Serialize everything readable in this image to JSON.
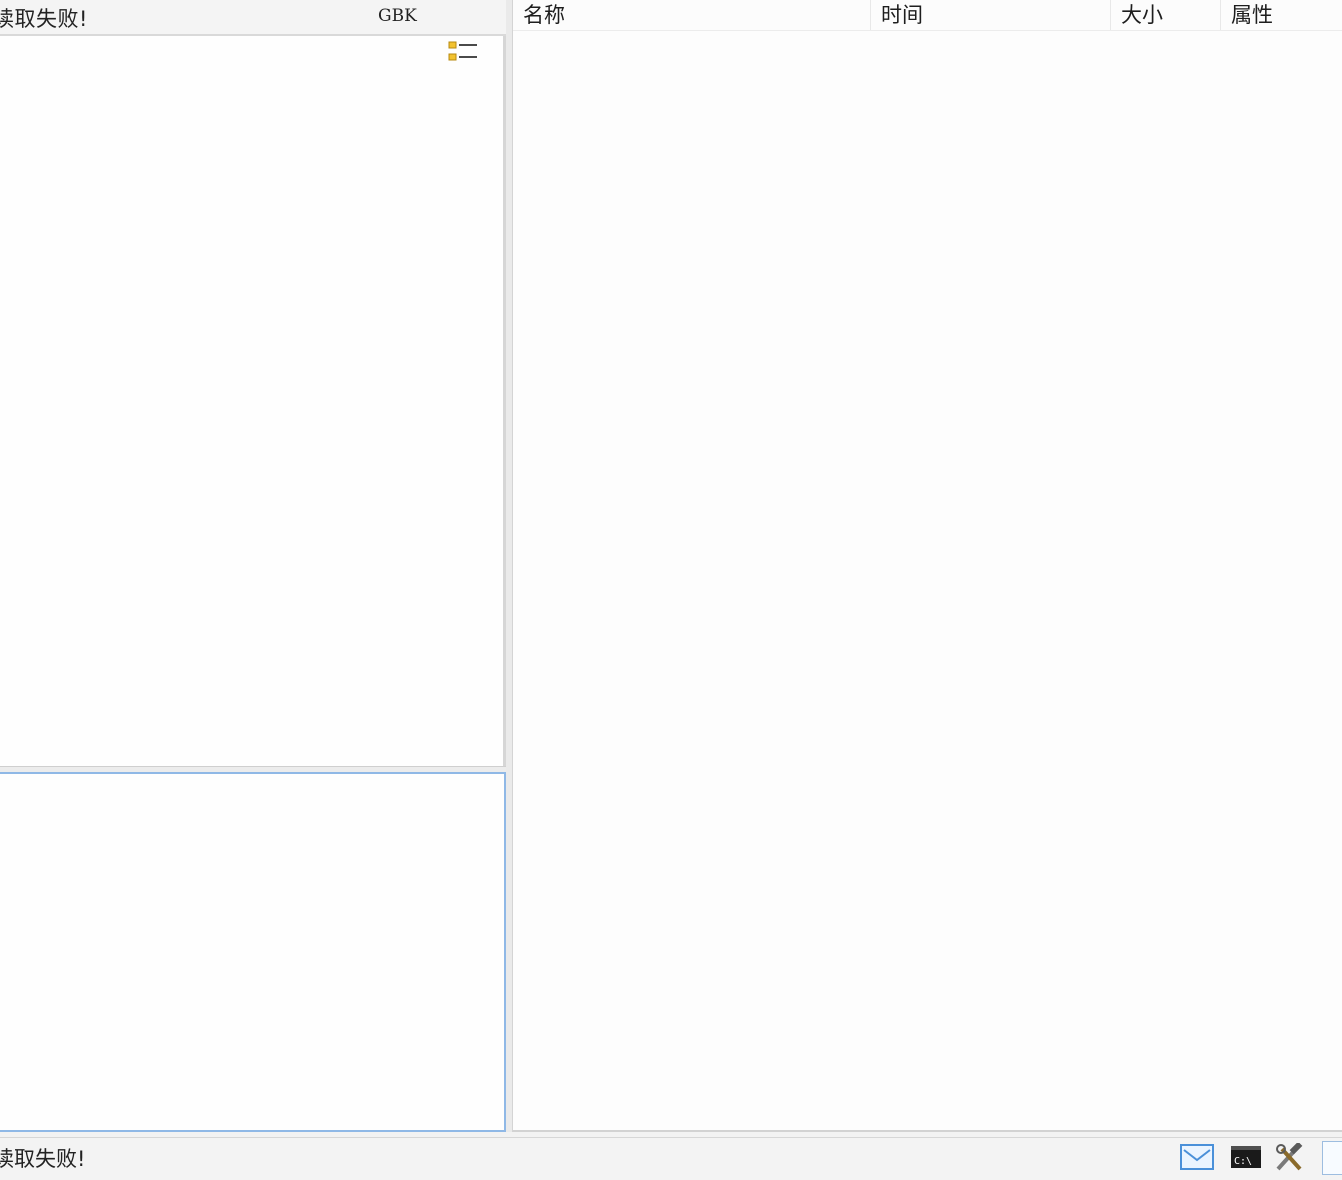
{
  "left_header": {
    "status": "读取失败!",
    "encoding": "GBK"
  },
  "file_list": {
    "columns": [
      "名称",
      "时间",
      "大小",
      "属性"
    ]
  },
  "status_bar": {
    "text": "读取失败!"
  },
  "icons": {
    "list_view": "list-view-icon",
    "mail": "mail-icon",
    "terminal": "terminal-icon",
    "tools": "tools-icon"
  }
}
